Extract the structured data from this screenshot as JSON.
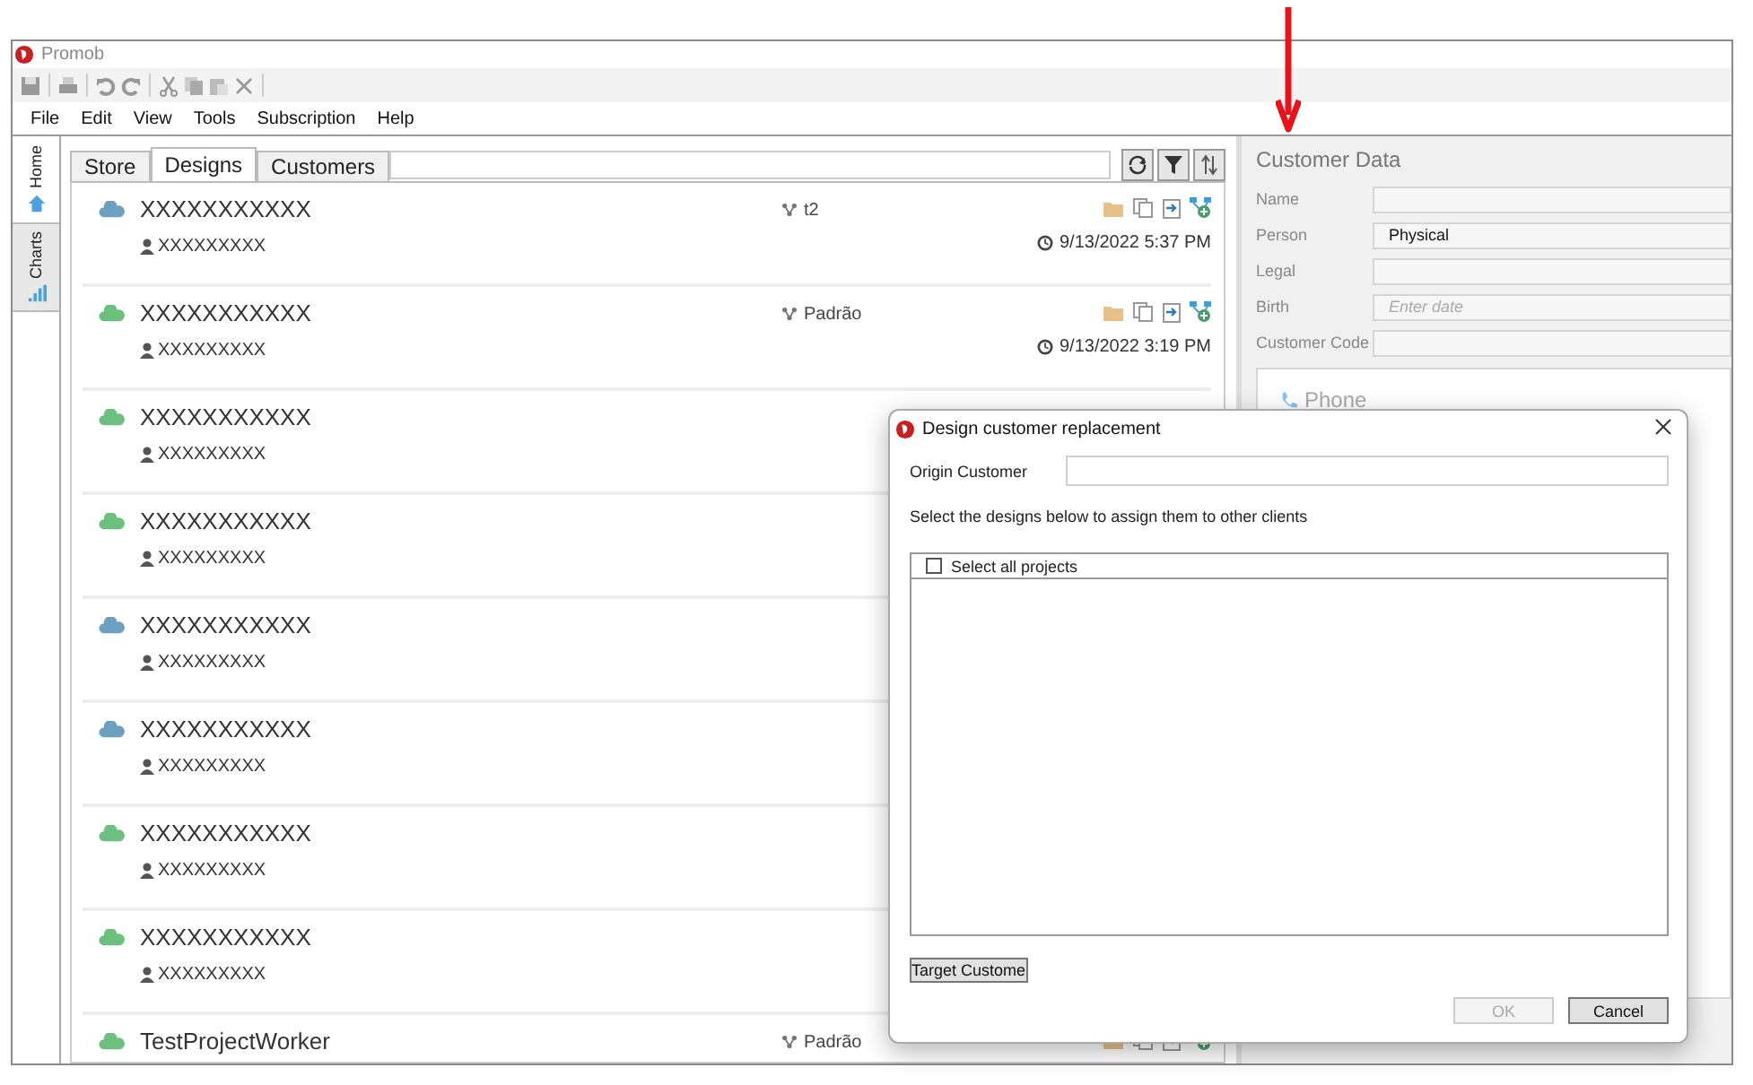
{
  "window": {
    "title": "Promob"
  },
  "menu": [
    "File",
    "Edit",
    "View",
    "Tools",
    "Subscription",
    "Help"
  ],
  "side_tabs": [
    {
      "label": "Home",
      "selected": true
    },
    {
      "label": "Charts",
      "selected": false
    }
  ],
  "tabs": [
    {
      "label": "Store",
      "selected": false
    },
    {
      "label": "Designs",
      "selected": true
    },
    {
      "label": "Customers",
      "selected": false
    }
  ],
  "designs": [
    {
      "title": "XXXXXXXXXXX",
      "owner": "XXXXXXXXX",
      "color": "#6d9fc0",
      "version": "t2",
      "date": "9/13/2022 5:37 PM"
    },
    {
      "title": "XXXXXXXXXXX",
      "owner": "XXXXXXXXX",
      "color": "#6cbf7e",
      "version": "Padrão",
      "date": "9/13/2022 3:19 PM"
    },
    {
      "title": "XXXXXXXXXXX",
      "owner": "XXXXXXXXX",
      "color": "#6cbf7e"
    },
    {
      "title": "XXXXXXXXXXX",
      "owner": "XXXXXXXXX",
      "color": "#6cbf7e"
    },
    {
      "title": "XXXXXXXXXXX",
      "owner": "XXXXXXXXX",
      "color": "#6d9fc0"
    },
    {
      "title": "XXXXXXXXXXX",
      "owner": "XXXXXXXXX",
      "color": "#6d9fc0"
    },
    {
      "title": "XXXXXXXXXXX",
      "owner": "XXXXXXXXX",
      "color": "#6cbf7e"
    },
    {
      "title": "XXXXXXXXXXX",
      "owner": "XXXXXXXXX",
      "color": "#6cbf7e"
    },
    {
      "title": "TestProjectWorker",
      "color": "#6cbf7e",
      "version": "Padrão"
    }
  ],
  "customer_data": {
    "title": "Customer Data",
    "fields": [
      {
        "label": "Name"
      },
      {
        "label": "Person",
        "value": "Physical"
      },
      {
        "label": "Legal"
      },
      {
        "label": "Birth",
        "placeholder": "Enter date"
      },
      {
        "label": "Customer Code"
      }
    ],
    "phone_label": "Phone"
  },
  "dialog": {
    "title": "Design customer replacement",
    "origin_label": "Origin Customer",
    "instruction": "Select the designs below to assign them to other clients",
    "select_all": {
      "label": "Select all projects",
      "checked": false
    },
    "target_button": "Target Custome",
    "buttons": [
      {
        "label": "OK",
        "disabled": true
      },
      {
        "label": "Cancel",
        "disabled": false
      }
    ]
  }
}
